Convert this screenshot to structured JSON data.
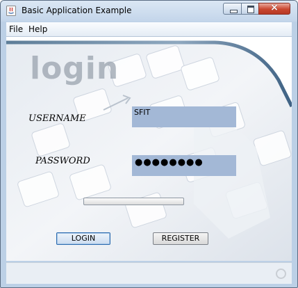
{
  "window": {
    "title": "Basic Application Example"
  },
  "menu": {
    "items": [
      "File",
      "Help"
    ]
  },
  "banner": {
    "logo_text": "login"
  },
  "form": {
    "username_label": "USERNAME",
    "username_value": "SFIT",
    "password_label": "PASSWORD",
    "password_mask": "●●●●●●●●"
  },
  "progress": {
    "value": 0
  },
  "buttons": {
    "login": "LOGIN",
    "register": "REGISTER"
  },
  "colors": {
    "field_bg": "#a3b8d6",
    "titlebar": "#c3d5ea",
    "close_button": "#c9462f"
  }
}
